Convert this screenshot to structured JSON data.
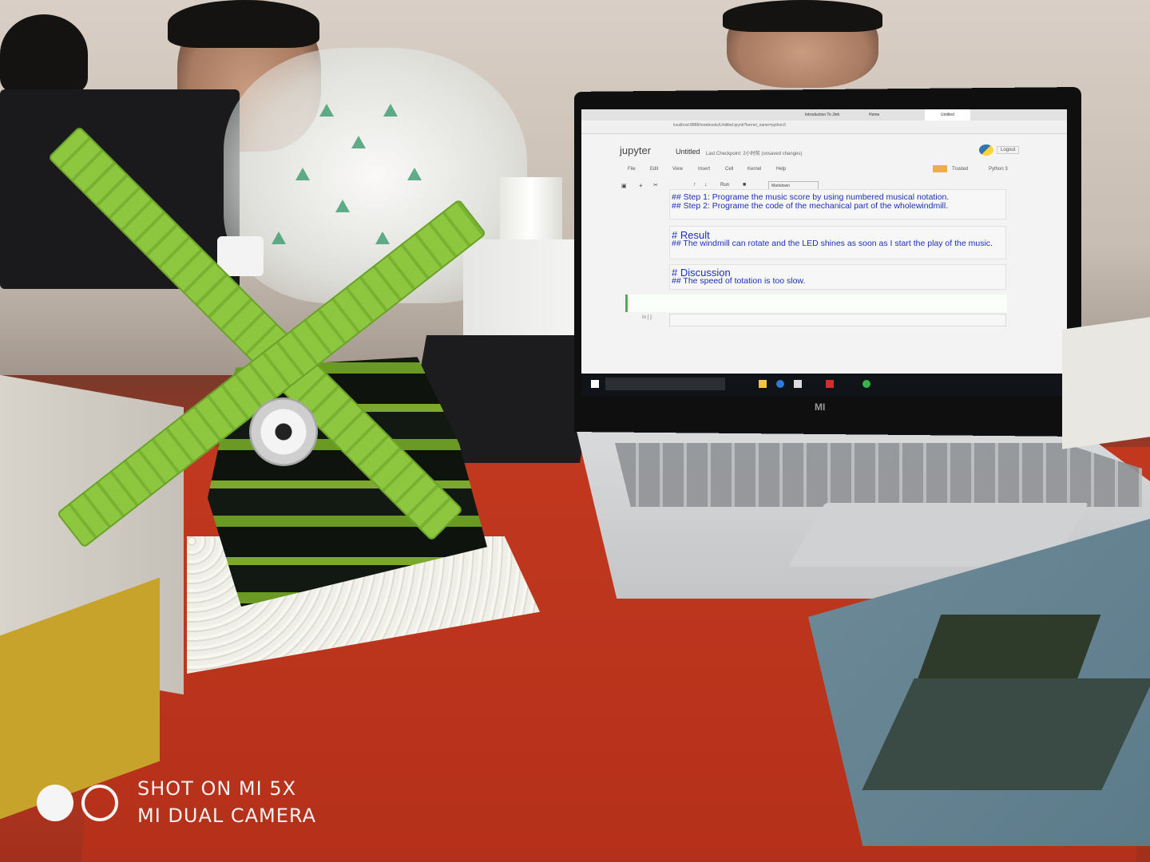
{
  "scene": {
    "description_kind": "photo",
    "colors": {
      "table": "#c23a22",
      "lego_green": "#8dc63f",
      "notebook_text": "#1b2fb8"
    }
  },
  "browser": {
    "tabs": [
      "Introduction To Jinh",
      "Home",
      "Untitled"
    ],
    "address": "localhost:8888/notebooks/Untitled.ipynb?kernel_name=python3"
  },
  "notebook": {
    "brand": "jupyter",
    "title": "Untitled",
    "checkpoint": "Last Checkpoint: 2小时前 (unsaved changes)",
    "logout": "Logout",
    "menus": [
      "File",
      "Edit",
      "View",
      "Insert",
      "Cell",
      "Kernel",
      "Help"
    ],
    "trusted": "Trusted",
    "kernel": "Python 3",
    "run_label": "Run",
    "cell_type": "Markdown",
    "cells": {
      "steps": [
        "## Step 1: Programe the music score by using numbered musical notation.",
        "## Step 2: Programe the code of the mechanical part of the wholewindmill."
      ],
      "result_heading": "# Result",
      "result_text": "## The windmill can rotate and the LED shines as soon as I start the play of the music.",
      "discussion_heading": "# Discussion",
      "discussion_text": "## The speed of totation is too slow.",
      "input_prompt": "In [ ]:"
    }
  },
  "laptop": {
    "brand": "MI"
  },
  "watermark": {
    "line1": "SHOT ON MI 5X",
    "line2": "MI DUAL CAMERA"
  }
}
